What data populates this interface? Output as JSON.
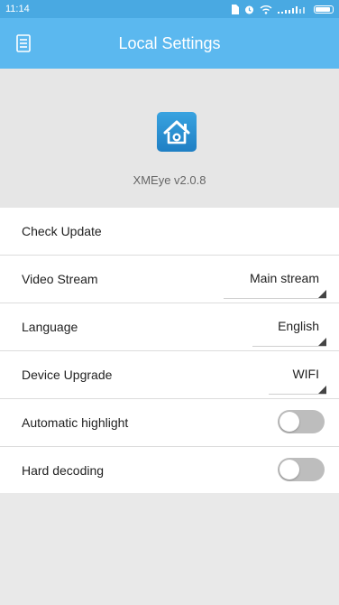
{
  "status_bar": {
    "time": "11:14",
    "icons": [
      "sim-icon",
      "alarm-icon",
      "wifi-icon",
      "signal-icon",
      "battery-icon"
    ]
  },
  "app_bar": {
    "title": "Local Settings",
    "menu_icon": "document-menu-icon"
  },
  "header": {
    "logo_icon": "home-camera-logo-icon",
    "version": "XMEye v2.0.8"
  },
  "settings": {
    "check_update": {
      "label": "Check Update"
    },
    "video_stream": {
      "label": "Video Stream",
      "value": "Main stream"
    },
    "language": {
      "label": "Language",
      "value": "English"
    },
    "device_upgrade": {
      "label": "Device Upgrade",
      "value": "WIFI"
    },
    "automatic_highlight": {
      "label": "Automatic highlight",
      "enabled": false
    },
    "hard_decoding": {
      "label": "Hard decoding",
      "enabled": false
    }
  },
  "colors": {
    "status_bar": "#49a9e2",
    "app_bar": "#5bb8ef",
    "background": "#e9e9e9",
    "toggle_off": "#bdbdbd"
  }
}
